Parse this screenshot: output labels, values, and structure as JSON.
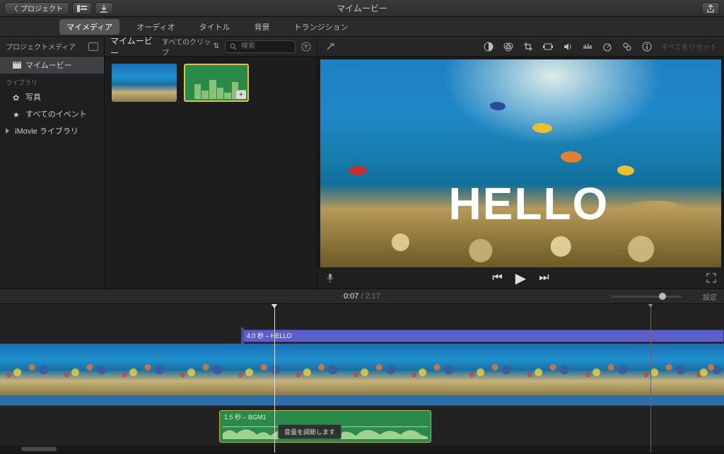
{
  "titlebar": {
    "back_label": "プロジェクト",
    "window_title": "マイムービー"
  },
  "tabs": {
    "mymedia": "マイメディア",
    "audio": "オーディオ",
    "title": "タイトル",
    "background": "背景",
    "transition": "トランジション"
  },
  "sidebar": {
    "header": "プロジェクトメディア",
    "project_item": "マイムービー",
    "section_library": "ライブラリ",
    "photos": "写真",
    "all_events": "すべてのイベント",
    "imovie_library": "iMovie ライブラリ"
  },
  "browser": {
    "title": "マイムービー",
    "clips_filter": "すべてのクリップ",
    "search_placeholder": "検索"
  },
  "preview": {
    "overlay_text": "HELLO",
    "reset_label": "すべてをリセット"
  },
  "transport": {
    "current_time": "0:07",
    "total_time": "2:17",
    "settings_label": "設定"
  },
  "timeline": {
    "title_clip_label": "4.0 秒 – HELLO",
    "bgm_clip_label": "1.5 秒 – BGM1",
    "bgm_tooltip": "音量を調節します"
  }
}
